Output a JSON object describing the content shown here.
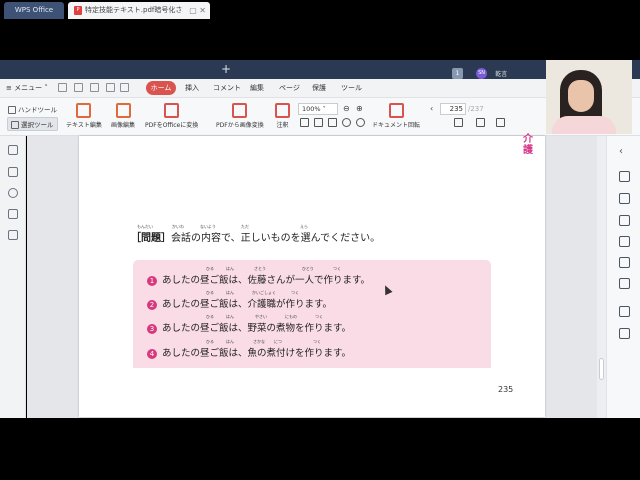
{
  "tabbar": {
    "app_tab": "WPS Office",
    "doc_tab": "特定技能テキスト.pdf暗号化された",
    "add_tab": "+",
    "user_name": "乾言"
  },
  "menu": {
    "menu_button": "メニュー",
    "tabs": [
      "ホーム",
      "挿入",
      "コメント",
      "編集",
      "ページ",
      "保護",
      "ツール"
    ]
  },
  "ribbon": {
    "hand_tool": "ハンドツール",
    "select_tool": "選択ツール",
    "buttons": [
      "テキスト編集",
      "画像編集",
      "PDFをOfficeに変換",
      "PDFから画像変換",
      "注釈",
      "ドキュメント回転"
    ],
    "zoom": "100%",
    "page_current": "235",
    "page_total": "/237"
  },
  "document": {
    "side_label": "介護",
    "question_head": "［問題］",
    "question_text": "会話の内容で、正しいものを選んでください。",
    "question_ruby": [
      "もんだい",
      "かいわ",
      "ないよう",
      "ただ",
      "えら"
    ],
    "options": [
      {
        "num": "1",
        "text": "あしたの昼ご飯は、佐藤さんが一人で作ります。"
      },
      {
        "num": "2",
        "text": "あしたの昼ご飯は、介護職が作ります。"
      },
      {
        "num": "3",
        "text": "あしたの昼ご飯は、野菜の煮物を作ります。"
      },
      {
        "num": "4",
        "text": "あしたの昼ご飯は、魚の煮付けを作ります。"
      }
    ],
    "option_ruby": [
      [
        "ひる",
        "はん",
        "さとう",
        "ひとり",
        "つく"
      ],
      [
        "ひる",
        "はん",
        "かいごしょく",
        "つく"
      ],
      [
        "ひる",
        "はん",
        "やさい",
        "にもの",
        "つく"
      ],
      [
        "ひる",
        "はん",
        "さかな",
        "につ",
        "つく"
      ]
    ],
    "page_number": "235"
  }
}
